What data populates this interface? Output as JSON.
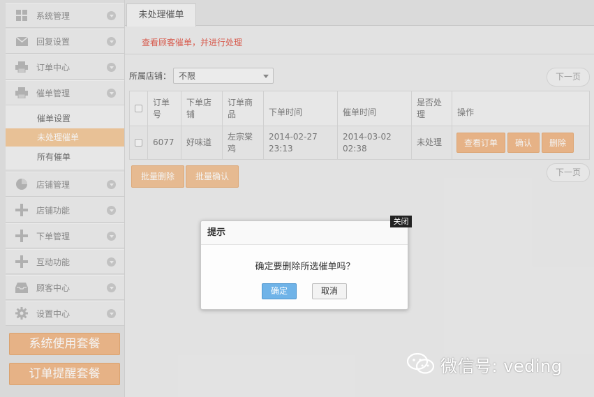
{
  "sidebar": {
    "menu": [
      {
        "label": "系统管理",
        "icon": "grid-icon"
      },
      {
        "label": "回复设置",
        "icon": "envelope-icon"
      },
      {
        "label": "订单中心",
        "icon": "printer-icon"
      },
      {
        "label": "催单管理",
        "icon": "printer-icon"
      },
      {
        "label": "店铺管理",
        "icon": "pie-chart-icon"
      },
      {
        "label": "店铺功能",
        "icon": "plus-icon"
      },
      {
        "label": "下单管理",
        "icon": "plus-icon"
      },
      {
        "label": "互动功能",
        "icon": "plus-icon"
      },
      {
        "label": "顾客中心",
        "icon": "inbox-icon"
      },
      {
        "label": "设置中心",
        "icon": "gear-icon"
      }
    ],
    "submenu": [
      "催单设置",
      "未处理催单",
      "所有催单"
    ],
    "plans": [
      "系统使用套餐",
      "订单提醒套餐"
    ]
  },
  "main": {
    "tab": "未处理催单",
    "hint": "查看顾客催单，并进行处理",
    "filter": {
      "label": "所属店铺：",
      "value": "不限"
    },
    "next_page": "下一页",
    "table": {
      "headers": [
        "订单号",
        "下单店铺",
        "订单商品",
        "下单时间",
        "催单时间",
        "是否处理",
        "操作"
      ],
      "rows": [
        {
          "order_no": "6077",
          "shop": "好味道",
          "product": "左宗棠鸡",
          "order_time": "2014-02-27 23:13",
          "remind_time": "2014-03-02 02:38",
          "status": "未处理",
          "actions": [
            "查看订单",
            "确认",
            "删除"
          ]
        }
      ]
    },
    "bulk_delete": "批量删除",
    "bulk_confirm": "批量确认"
  },
  "dialog": {
    "title": "提示",
    "message": "确定要删除所选催单吗？",
    "ok": "确定",
    "cancel": "取消",
    "close": "关闭"
  },
  "watermark": {
    "text": "微信号: veding"
  }
}
